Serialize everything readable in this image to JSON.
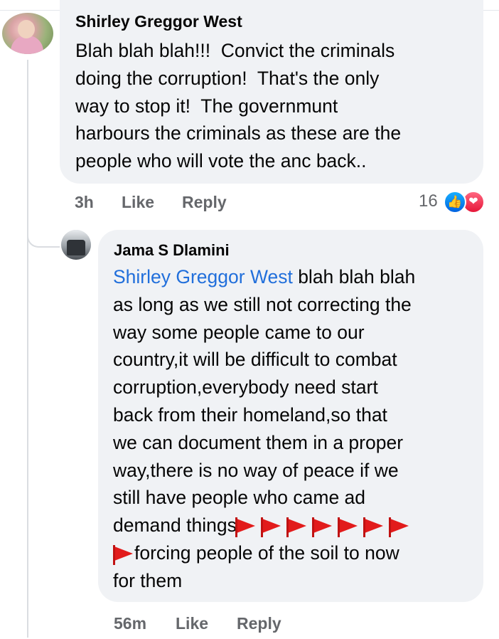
{
  "comment1": {
    "author": "Shirley Greggor West",
    "lines": [
      "Blah blah blah!!!  Convict the criminals",
      "doing the corruption!  That's the only",
      "way to stop it!  The governmunt",
      "harbours the criminals as these are the",
      "people who will vote the anc back.."
    ],
    "time": "3h",
    "like_label": "Like",
    "reply_label": "Reply",
    "reaction_count": "16",
    "reactions": [
      "like-icon",
      "love-icon"
    ]
  },
  "comment2": {
    "author": "Jama S Dlamini",
    "mention": "Shirley Greggor West",
    "first_line_rest": " blah blah blah",
    "lines": [
      "as long as we still not correcting the",
      "way some people came to our",
      "country,it will be difficult to combat",
      "corruption,everybody need start",
      "back from their homeland,so that",
      "we can document them in a proper",
      "way,there is no way of peace if we",
      "still have people who came ad"
    ],
    "line_before_flags": "demand things",
    "line_after_flag": "forcing people of the soil to now",
    "last_line": "for them",
    "flag_icon": "red-triangular-flag-icon",
    "time": "56m",
    "like_label": "Like",
    "reply_label": "Reply"
  },
  "colors": {
    "bubble": "#f0f2f5",
    "mention": "#216fdb",
    "meta": "#65676b",
    "flag": "#e21b1b"
  }
}
